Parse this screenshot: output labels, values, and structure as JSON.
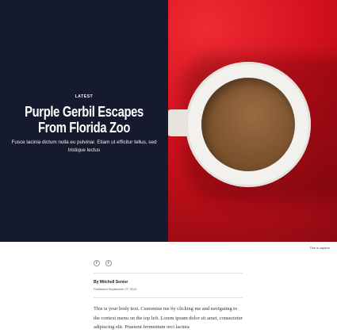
{
  "hero": {
    "eyebrow": "LATEST",
    "headline": "Purple Gerbil Escapes From Florida Zoo",
    "dek": "Fusce lacinia dictum nulla eu pulvinar. Etiam ut efficitur tellus, sed tristique lectus",
    "image_alt_icon": "coffee-mug-photo"
  },
  "caption": "This is caption.",
  "share": {
    "facebook_icon": "f",
    "twitter_icon": "t"
  },
  "byline": {
    "author": "By Mitchell Senior",
    "published": "Published September 27, 2021"
  },
  "body": {
    "text": "This is your body text. Customise me by clicking me and navigating to the context menu on the top left. Lorem ipsum dolor sit amet, consectetur adipiscing elit. Praesent fermentum orci lacinia"
  },
  "colors": {
    "hero_left_bg": "#151a2e",
    "hero_right_bg": "#c8121e"
  }
}
